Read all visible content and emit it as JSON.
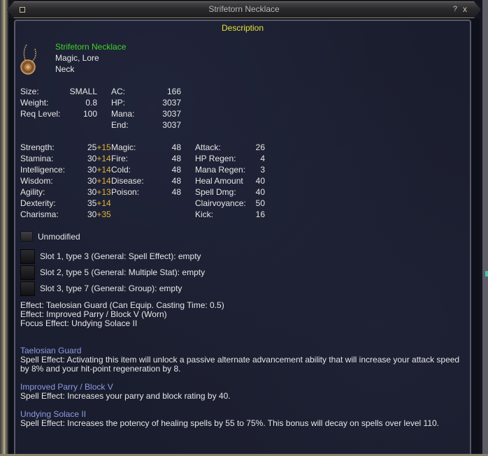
{
  "window": {
    "title": "Strifetorn Necklace",
    "help_label": "?",
    "close_label": "x",
    "section_title": "Description"
  },
  "item": {
    "icon": "necklace-icon",
    "name": "Strifetorn Necklace",
    "flags": "Magic, Lore",
    "slot": "Neck"
  },
  "basic_stats": [
    {
      "label": "Size:",
      "value": "SMALL"
    },
    {
      "label": "Weight:",
      "value": "0.8"
    },
    {
      "label": "Req Level:",
      "value": "100"
    }
  ],
  "vitals": [
    {
      "label": "AC:",
      "value": "166"
    },
    {
      "label": "HP:",
      "value": "3037"
    },
    {
      "label": "Mana:",
      "value": "3037"
    },
    {
      "label": "End:",
      "value": "3037"
    }
  ],
  "attributes": [
    {
      "label": "Strength:",
      "base": "25",
      "bonus": "+15"
    },
    {
      "label": "Stamina:",
      "base": "30",
      "bonus": "+14"
    },
    {
      "label": "Intelligence:",
      "base": "30",
      "bonus": "+14"
    },
    {
      "label": "Wisdom:",
      "base": "30",
      "bonus": "+14"
    },
    {
      "label": "Agility:",
      "base": "30",
      "bonus": "+13"
    },
    {
      "label": "Dexterity:",
      "base": "35",
      "bonus": "+14"
    },
    {
      "label": "Charisma:",
      "base": "30",
      "bonus": "+35"
    }
  ],
  "resists": [
    {
      "label": "Magic:",
      "value": "48"
    },
    {
      "label": "Fire:",
      "value": "48"
    },
    {
      "label": "Cold:",
      "value": "48"
    },
    {
      "label": "Disease:",
      "value": "48"
    },
    {
      "label": "Poison:",
      "value": "48"
    }
  ],
  "mods": [
    {
      "label": "Attack:",
      "value": "26"
    },
    {
      "label": "HP Regen:",
      "value": "4"
    },
    {
      "label": "Mana Regen:",
      "value": "3"
    },
    {
      "label": "Heal Amount",
      "value": "40"
    },
    {
      "label": "Spell Dmg:",
      "value": "40"
    },
    {
      "label": "Clairvoyance:",
      "value": "50"
    },
    {
      "label": "Kick:",
      "value": "16"
    }
  ],
  "unmodified_label": "Unmodified",
  "augment_slots": [
    "Slot 1, type 3 (General: Spell Effect): empty",
    "Slot 2, type 5 (General: Multiple Stat): empty",
    "Slot 3, type 7 (General: Group): empty"
  ],
  "effects": [
    "Effect: Taelosian Guard (Can Equip. Casting Time: 0.5)",
    "Effect: Improved Parry / Block V (Worn)",
    "Focus Effect: Undying Solace II"
  ],
  "spells": [
    {
      "name": "Taelosian Guard",
      "lines": [
        "Spell Effect: Activating this item will unlock a passive alternate advancement ability that will increase your attack speed",
        "by 8% and your hit-point regeneration by 8."
      ]
    },
    {
      "name": "Improved Parry / Block V",
      "lines": [
        "Spell Effect: Increases your parry and block rating by 40."
      ]
    },
    {
      "name": "Undying Solace II",
      "lines": [
        "Spell Effect: Increases the potency of healing spells by 55 to 75%. This bonus will decay on spells over level 110."
      ]
    }
  ]
}
